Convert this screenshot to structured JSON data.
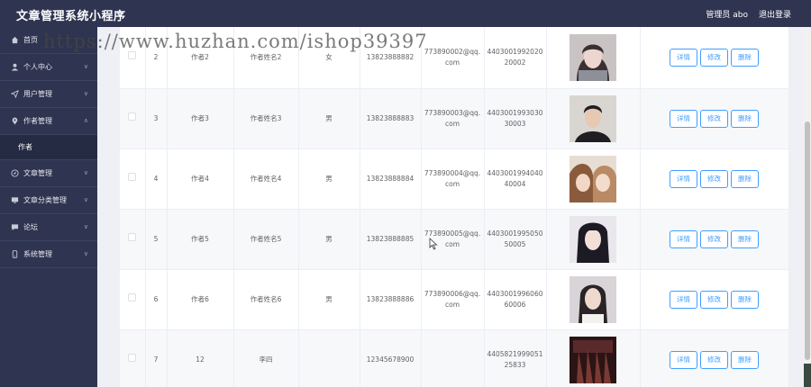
{
  "app": {
    "title": "文章管理系统小程序"
  },
  "header": {
    "admin_label": "管理员 abo",
    "logout_label": "退出登录"
  },
  "watermark": "https://www.huzhan.com/ishop39397",
  "sidebar": {
    "items": [
      {
        "label": "首页",
        "icon": "home-icon"
      },
      {
        "label": "个人中心",
        "icon": "user-icon"
      },
      {
        "label": "用户管理",
        "icon": "send-icon"
      },
      {
        "label": "作者管理",
        "icon": "pin-icon",
        "expanded": true,
        "sub": [
          "作者"
        ]
      },
      {
        "label": "文章管理",
        "icon": "compass-icon"
      },
      {
        "label": "文章分类管理",
        "icon": "monitor-icon"
      },
      {
        "label": "论坛",
        "icon": "chat-icon"
      },
      {
        "label": "系统管理",
        "icon": "phone-icon"
      }
    ]
  },
  "table": {
    "rows": [
      {
        "index": "2",
        "name": "作者2",
        "real_name": "作者姓名2",
        "gender": "女",
        "phone": "13823888882",
        "email": "773890002@qq.com",
        "id_card": "440300199202020002",
        "avatar": "avatar-woman-1"
      },
      {
        "index": "3",
        "name": "作者3",
        "real_name": "作者姓名3",
        "gender": "男",
        "phone": "13823888883",
        "email": "773890003@qq.com",
        "id_card": "440300199303030003",
        "avatar": "avatar-man"
      },
      {
        "index": "4",
        "name": "作者4",
        "real_name": "作者姓名4",
        "gender": "男",
        "phone": "13823888884",
        "email": "773890004@qq.com",
        "id_card": "440300199404040004",
        "avatar": "avatar-couple"
      },
      {
        "index": "5",
        "name": "作者5",
        "real_name": "作者姓名5",
        "gender": "男",
        "phone": "13823888885",
        "email": "773890005@qq.com",
        "id_card": "440300199505050005",
        "avatar": "avatar-woman-2"
      },
      {
        "index": "6",
        "name": "作者6",
        "real_name": "作者姓名6",
        "gender": "男",
        "phone": "13823888886",
        "email": "773890006@qq.com",
        "id_card": "440300199606060006",
        "avatar": "avatar-woman-3"
      },
      {
        "index": "7",
        "name": "12",
        "real_name": "李四",
        "gender": "",
        "phone": "12345678900",
        "email": "",
        "id_card": "440582199905125833",
        "avatar": "avatar-dark-poster"
      }
    ],
    "actions": {
      "detail": "详情",
      "edit": "修改",
      "delete": "删除"
    }
  },
  "colors": {
    "sidebar_bg": "#2f3450",
    "button_blue": "#409eff",
    "stripe": "#f7f8fa"
  }
}
